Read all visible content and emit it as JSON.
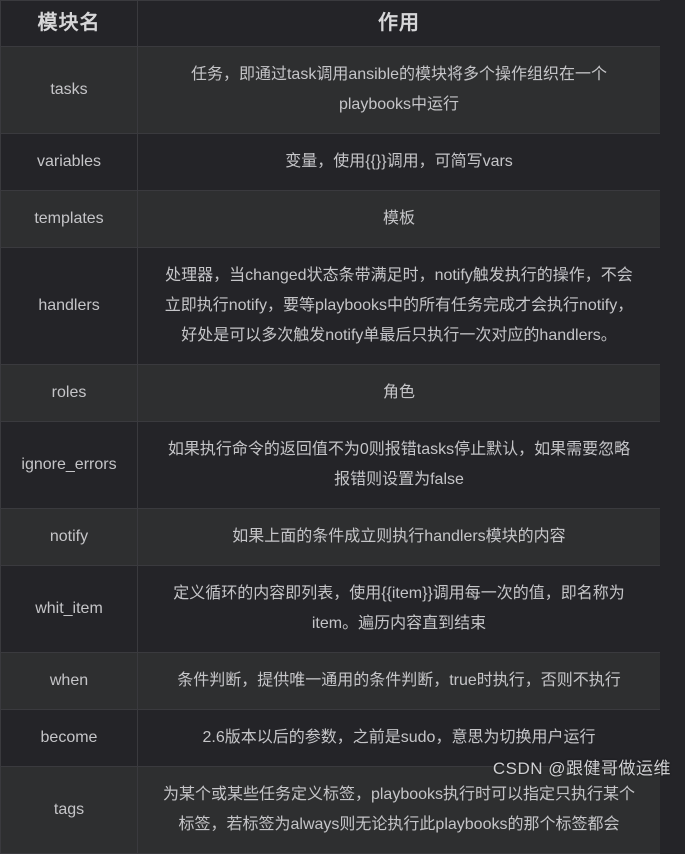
{
  "table": {
    "headers": [
      "模块名",
      "作用"
    ],
    "rows": [
      {
        "name": "tasks",
        "desc": "任务，即通过task调用ansible的模块将多个操作组织在一个playbooks中运行"
      },
      {
        "name": "variables",
        "desc": "变量，使用{{}}调用，可简写vars"
      },
      {
        "name": "templates",
        "desc": "模板"
      },
      {
        "name": "handlers",
        "desc": "处理器，当changed状态条带满足时，notify触发执行的操作，不会立即执行notify，要等playbooks中的所有任务完成才会执行notify，好处是可以多次触发notify单最后只执行一次对应的handlers。"
      },
      {
        "name": "roles",
        "desc": "角色"
      },
      {
        "name": "ignore_errors",
        "desc": "如果执行命令的返回值不为0则报错tasks停止默认，如果需要忽略报错则设置为false"
      },
      {
        "name": "notify",
        "desc": "如果上面的条件成立则执行handlers模块的内容"
      },
      {
        "name": "whit_item",
        "desc": "定义循环的内容即列表，使用{{item}}调用每一次的值，即名称为item。遍历内容直到结束"
      },
      {
        "name": "when",
        "desc": "条件判断，提供唯一通用的条件判断，true时执行，否则不执行"
      },
      {
        "name": "become",
        "desc": "2.6版本以后的参数，之前是sudo，意思为切换用户运行"
      },
      {
        "name": "tags",
        "desc": "为某个或某些任务定义标签，playbooks执行时可以指定只执行某个标签，若标签为always则无论执行此playbooks的那个标签都会"
      }
    ]
  },
  "watermark": {
    "text": "CSDN @跟健哥做运维"
  },
  "colors": {
    "page_background": "#242428",
    "row_odd": "#2e2f30",
    "row_even": "#242428",
    "header_background": "#242428",
    "border": "#3a3a3e",
    "text": "#c5c5c8",
    "header_text": "#d6d6d8"
  }
}
